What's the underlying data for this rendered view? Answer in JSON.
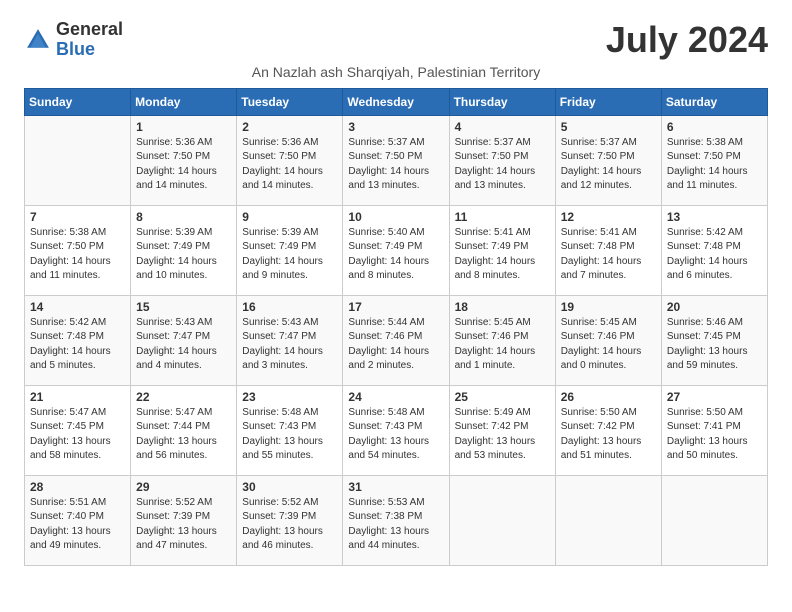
{
  "logo": {
    "general": "General",
    "blue": "Blue"
  },
  "title": "July 2024",
  "location": "An Nazlah ash Sharqiyah, Palestinian Territory",
  "days_of_week": [
    "Sunday",
    "Monday",
    "Tuesday",
    "Wednesday",
    "Thursday",
    "Friday",
    "Saturday"
  ],
  "weeks": [
    [
      {
        "day": "",
        "info": ""
      },
      {
        "day": "1",
        "info": "Sunrise: 5:36 AM\nSunset: 7:50 PM\nDaylight: 14 hours\nand 14 minutes."
      },
      {
        "day": "2",
        "info": "Sunrise: 5:36 AM\nSunset: 7:50 PM\nDaylight: 14 hours\nand 14 minutes."
      },
      {
        "day": "3",
        "info": "Sunrise: 5:37 AM\nSunset: 7:50 PM\nDaylight: 14 hours\nand 13 minutes."
      },
      {
        "day": "4",
        "info": "Sunrise: 5:37 AM\nSunset: 7:50 PM\nDaylight: 14 hours\nand 13 minutes."
      },
      {
        "day": "5",
        "info": "Sunrise: 5:37 AM\nSunset: 7:50 PM\nDaylight: 14 hours\nand 12 minutes."
      },
      {
        "day": "6",
        "info": "Sunrise: 5:38 AM\nSunset: 7:50 PM\nDaylight: 14 hours\nand 11 minutes."
      }
    ],
    [
      {
        "day": "7",
        "info": "Sunrise: 5:38 AM\nSunset: 7:50 PM\nDaylight: 14 hours\nand 11 minutes."
      },
      {
        "day": "8",
        "info": "Sunrise: 5:39 AM\nSunset: 7:49 PM\nDaylight: 14 hours\nand 10 minutes."
      },
      {
        "day": "9",
        "info": "Sunrise: 5:39 AM\nSunset: 7:49 PM\nDaylight: 14 hours\nand 9 minutes."
      },
      {
        "day": "10",
        "info": "Sunrise: 5:40 AM\nSunset: 7:49 PM\nDaylight: 14 hours\nand 8 minutes."
      },
      {
        "day": "11",
        "info": "Sunrise: 5:41 AM\nSunset: 7:49 PM\nDaylight: 14 hours\nand 8 minutes."
      },
      {
        "day": "12",
        "info": "Sunrise: 5:41 AM\nSunset: 7:48 PM\nDaylight: 14 hours\nand 7 minutes."
      },
      {
        "day": "13",
        "info": "Sunrise: 5:42 AM\nSunset: 7:48 PM\nDaylight: 14 hours\nand 6 minutes."
      }
    ],
    [
      {
        "day": "14",
        "info": "Sunrise: 5:42 AM\nSunset: 7:48 PM\nDaylight: 14 hours\nand 5 minutes."
      },
      {
        "day": "15",
        "info": "Sunrise: 5:43 AM\nSunset: 7:47 PM\nDaylight: 14 hours\nand 4 minutes."
      },
      {
        "day": "16",
        "info": "Sunrise: 5:43 AM\nSunset: 7:47 PM\nDaylight: 14 hours\nand 3 minutes."
      },
      {
        "day": "17",
        "info": "Sunrise: 5:44 AM\nSunset: 7:46 PM\nDaylight: 14 hours\nand 2 minutes."
      },
      {
        "day": "18",
        "info": "Sunrise: 5:45 AM\nSunset: 7:46 PM\nDaylight: 14 hours\nand 1 minute."
      },
      {
        "day": "19",
        "info": "Sunrise: 5:45 AM\nSunset: 7:46 PM\nDaylight: 14 hours\nand 0 minutes."
      },
      {
        "day": "20",
        "info": "Sunrise: 5:46 AM\nSunset: 7:45 PM\nDaylight: 13 hours\nand 59 minutes."
      }
    ],
    [
      {
        "day": "21",
        "info": "Sunrise: 5:47 AM\nSunset: 7:45 PM\nDaylight: 13 hours\nand 58 minutes."
      },
      {
        "day": "22",
        "info": "Sunrise: 5:47 AM\nSunset: 7:44 PM\nDaylight: 13 hours\nand 56 minutes."
      },
      {
        "day": "23",
        "info": "Sunrise: 5:48 AM\nSunset: 7:43 PM\nDaylight: 13 hours\nand 55 minutes."
      },
      {
        "day": "24",
        "info": "Sunrise: 5:48 AM\nSunset: 7:43 PM\nDaylight: 13 hours\nand 54 minutes."
      },
      {
        "day": "25",
        "info": "Sunrise: 5:49 AM\nSunset: 7:42 PM\nDaylight: 13 hours\nand 53 minutes."
      },
      {
        "day": "26",
        "info": "Sunrise: 5:50 AM\nSunset: 7:42 PM\nDaylight: 13 hours\nand 51 minutes."
      },
      {
        "day": "27",
        "info": "Sunrise: 5:50 AM\nSunset: 7:41 PM\nDaylight: 13 hours\nand 50 minutes."
      }
    ],
    [
      {
        "day": "28",
        "info": "Sunrise: 5:51 AM\nSunset: 7:40 PM\nDaylight: 13 hours\nand 49 minutes."
      },
      {
        "day": "29",
        "info": "Sunrise: 5:52 AM\nSunset: 7:39 PM\nDaylight: 13 hours\nand 47 minutes."
      },
      {
        "day": "30",
        "info": "Sunrise: 5:52 AM\nSunset: 7:39 PM\nDaylight: 13 hours\nand 46 minutes."
      },
      {
        "day": "31",
        "info": "Sunrise: 5:53 AM\nSunset: 7:38 PM\nDaylight: 13 hours\nand 44 minutes."
      },
      {
        "day": "",
        "info": ""
      },
      {
        "day": "",
        "info": ""
      },
      {
        "day": "",
        "info": ""
      }
    ]
  ]
}
